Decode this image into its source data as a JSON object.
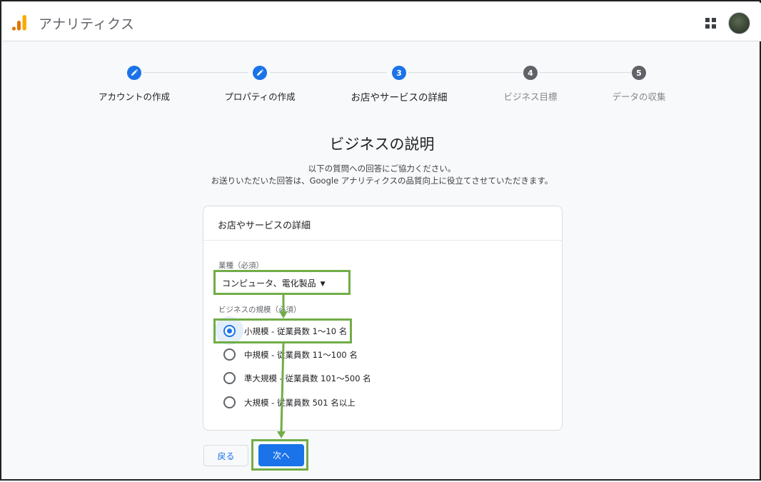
{
  "header": {
    "app_title": "アナリティクス",
    "logo_icon": "analytics-logo-icon",
    "apps_icon": "apps-grid-icon",
    "avatar": "user-avatar"
  },
  "stepper": {
    "steps": [
      {
        "label": "アカウントの作成",
        "state": "done",
        "number": "1"
      },
      {
        "label": "プロパティの作成",
        "state": "done",
        "number": "2"
      },
      {
        "label": "お店やサービスの詳細",
        "state": "active",
        "number": "3"
      },
      {
        "label": "ビジネス目標",
        "state": "pending",
        "number": "4"
      },
      {
        "label": "データの収集",
        "state": "pending",
        "number": "5"
      }
    ]
  },
  "page": {
    "title": "ビジネスの説明",
    "subtitle_1": "以下の質問への回答にご協力ください。",
    "subtitle_2": "お送りいただいた回答は、Google アナリティクスの品質向上に役立てさせていただきます。"
  },
  "card": {
    "title": "お店やサービスの詳細",
    "industry_label": "業種（必須）",
    "industry_value": "コンピュータ、電化製品",
    "size_label": "ビジネスの規模（必須）",
    "size_options": [
      {
        "label": "小規模 - 従業員数 1～10 名",
        "checked": true
      },
      {
        "label": "中規模 - 従業員数 11～100 名",
        "checked": false
      },
      {
        "label": "準大規模 - 従業員数 101～500 名",
        "checked": false
      },
      {
        "label": "大規模 - 従業員数 501 名以上",
        "checked": false
      }
    ]
  },
  "buttons": {
    "back": "戻る",
    "next": "次へ"
  },
  "colors": {
    "accent": "#1a73e8",
    "annotation": "#70ad47",
    "pending_step": "#5f6368"
  }
}
